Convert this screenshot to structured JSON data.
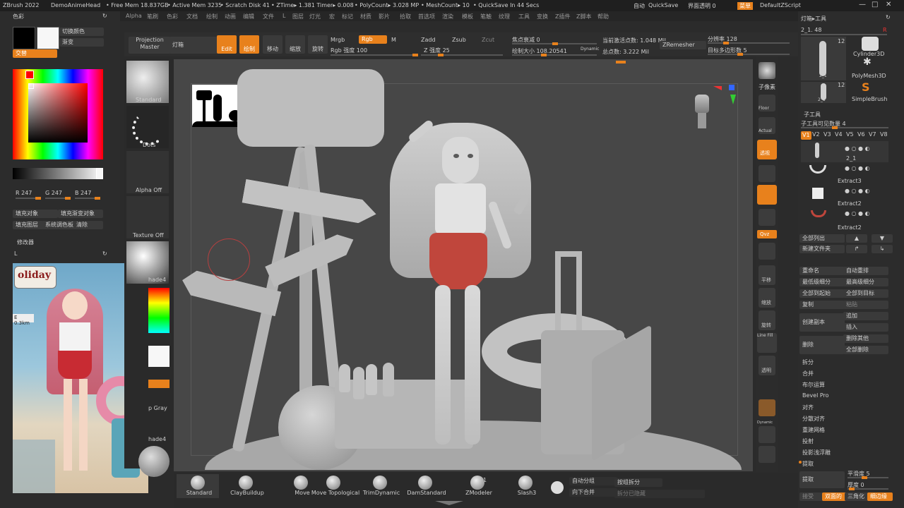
{
  "top": {
    "app": "ZBrush 2022",
    "doc": "DemoAnimeHead",
    "free_mem": "• Free Mem 18.837GB",
    "active_mem": "• Active Mem 3235",
    "scratch": "• Scratch Disk 41",
    "ztime": "• ZTime▸ 1.381 Timer▸ 0.008",
    "polycount": "• PolyCount▸ 3.028 MP",
    "meshcount": "• MeshCount▸ 10",
    "quicksave_in": "• QuickSave In 44 Secs",
    "auto": "自动",
    "quicksave": "QuickSave",
    "transparency": "界面透明 0",
    "menu": "菜单",
    "script": "DefaultZScript"
  },
  "menus": [
    "Alpha",
    "笔刷",
    "色彩",
    "文档",
    "绘制",
    "动画",
    "编辑",
    "文件",
    "L",
    "图层",
    "灯光",
    "宏",
    "标记",
    "材质",
    "影片",
    "拾取",
    "首选项",
    "渲染",
    "模板",
    "笔触",
    "纹理",
    "工具",
    "变换",
    "Z插件",
    "Z脚本",
    "帮助"
  ],
  "left": {
    "color_title": "色彩",
    "switch_color": "切换颜色",
    "gradient": "渐变",
    "alternate": "交替",
    "r": "R 247",
    "g": "G 247",
    "b": "B 247",
    "fill_obj": "填充对象",
    "fill_grad": "填充渐变对象",
    "fill_layer": "填充图层",
    "sys_color": "系统调色板",
    "clear": "清除",
    "modifier": "修改器",
    "l": "L",
    "ref_sign": "oliday",
    "ref_dist": "E 0.3km"
  },
  "tray": {
    "projection": "Projection Master",
    "lightbox": "灯箱",
    "standard": "Standard",
    "dots": "Dots",
    "alpha_off": "Alpha Off",
    "texture_off": "Texture Off",
    "mat": "hade4",
    "gray": "p Gray",
    "mat2": "hade4"
  },
  "toolbar": {
    "edit": "Edit",
    "draw": "绘制",
    "move": "移动",
    "scale": "缩放",
    "rotate": "旋转",
    "mrgb": "Mrgb",
    "rgb": "Rgb",
    "m": "M",
    "rgb_int": "Rgb 强度 100",
    "zadd": "Zadd",
    "zsub": "Zsub",
    "zcut": "Zcut",
    "z_int": "Z 强度 25",
    "focal": "焦点衰减 0",
    "draw_size": "绘制大小 108.20541",
    "dynamic": "Dynamic",
    "active_pts": "当前激活点数: 1.048 Mil",
    "total_pts": "总点数: 3.222 Mil",
    "zremesher": "ZRemesher",
    "resolution": "分辨率 128",
    "target_poly": "目标多边形数 5"
  },
  "right_tb": [
    "子像素",
    "Floor",
    "Actual",
    "透视",
    "平移",
    "缩放",
    "旋转",
    "Line Fill",
    "透明",
    "Dynamic"
  ],
  "right_tb_extra": {
    "persp": "透视",
    "pivot": "中心",
    "qvz": "Qvz",
    "solo": "Solo"
  },
  "rp": {
    "header": "灯箱▸工具",
    "tool_name": "2_1. 48",
    "count1": "12",
    "count2": "12",
    "cylinder": "Cylinder3D",
    "polymesh": "PolyMesh3D",
    "simplebrush": "SimpleBrush",
    "item1": "2_1",
    "item2": "2_1",
    "subtool": "子工具",
    "visible": "子工具可见数量 4",
    "versions": [
      "V1",
      "V2",
      "V3",
      "V4",
      "V5",
      "V6",
      "V7",
      "V8"
    ],
    "sub_names": [
      "2_1",
      "Extract3",
      "Extract2",
      "Extract2"
    ],
    "list_all": "全部列出",
    "new_folder": "新建文件夹",
    "rename": "重命名",
    "auto_reorder": "自动重排",
    "lowest_sub": "最低级细分",
    "highest_sub": "最高级细分",
    "all_to_start": "全部到起始",
    "all_to_target": "全部到目标",
    "copy": "复制",
    "paste": "粘贴",
    "create_inst": "创建副本",
    "append": "追加",
    "insert": "插入",
    "delete": "删除",
    "del_other": "删除其他",
    "del_all": "全部删除",
    "split": "拆分",
    "merge": "合并",
    "boolean": "布尔运算",
    "bevel": "Bevel Pro",
    "align": "对齐",
    "distribute": "分散对齐",
    "remesh": "重建网格",
    "project": "投射",
    "proj_shell": "投影浅浮雕",
    "extract_hdr": "提取",
    "extract": "提取",
    "smooth": "平滑度 5",
    "thickness": "厚度 0",
    "accept": "接受",
    "double": "双面的",
    "tri": "三角化",
    "tcorne": "细边缘"
  },
  "bottom": {
    "brushes": [
      "Standard",
      "ClayBuildup",
      "Move",
      "Move Topological",
      "TrimDynamic",
      "DamStandard",
      "ZModeler",
      "Slash3"
    ],
    "zmodeler_num": "1",
    "auto_group": "自动分组",
    "merge_down": "向下合并",
    "split_group": "按组拆分",
    "split_hidden": "拆分已隐藏"
  },
  "colors": {
    "accent": "#e8811c",
    "panel": "#2c2c2c",
    "viewport": "#474747"
  }
}
